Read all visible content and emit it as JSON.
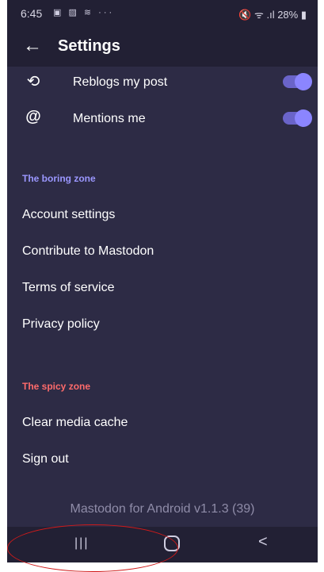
{
  "status_bar": {
    "time": "6:45",
    "notification_icons": "▣ ▨ ≋ ···",
    "right_icons": "🔇 ᯤ .ıl 28% ▮"
  },
  "app_bar": {
    "back_glyph": "←",
    "title": "Settings"
  },
  "notifications": {
    "items": [
      {
        "icon_glyph": "⟲",
        "icon": "reblog-icon",
        "label": "Reblogs my post",
        "toggle_on": true
      },
      {
        "icon_glyph": "@",
        "icon": "at-icon",
        "label": "Mentions me",
        "toggle_on": true
      }
    ]
  },
  "boring_zone": {
    "header": "The boring zone",
    "header_color": "#9b97ff",
    "items": [
      "Account settings",
      "Contribute to Mastodon",
      "Terms of service",
      "Privacy policy"
    ]
  },
  "spicy_zone": {
    "header": "The spicy zone",
    "header_color": "#ff6b6b",
    "items": [
      "Clear media cache",
      "Sign out"
    ]
  },
  "footer": {
    "version": "Mastodon for Android v1.1.3 (39)"
  },
  "nav_bar": {
    "recent_glyph": "|||",
    "back_glyph": "<"
  },
  "colors": {
    "background": "#2d2b45",
    "bars": "#222034",
    "toggle_on": "#8b85ff",
    "annotation": "#d11a1a"
  }
}
